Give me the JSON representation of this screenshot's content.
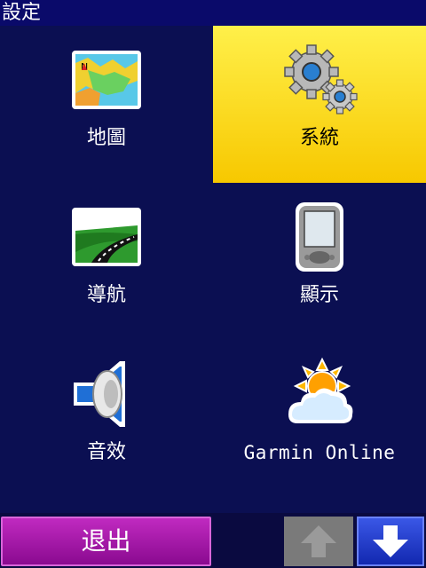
{
  "title": "設定",
  "colors": {
    "background": "#0b0f52",
    "selected": "#f7c800",
    "exit_button": "#a31aa8",
    "down_button": "#1f3ad0",
    "up_button_disabled": "#7a7a7a"
  },
  "tiles": [
    {
      "label": "地圖",
      "icon": "map-icon",
      "selected": false
    },
    {
      "label": "系統",
      "icon": "gears-icon",
      "selected": true
    },
    {
      "label": "導航",
      "icon": "road-icon",
      "selected": false
    },
    {
      "label": "顯示",
      "icon": "pda-display-icon",
      "selected": false
    },
    {
      "label": "音效",
      "icon": "speaker-icon",
      "selected": false
    },
    {
      "label": "Garmin Online",
      "icon": "weather-icon",
      "selected": false
    }
  ],
  "bottom": {
    "exit_label": "退出",
    "up_icon": "arrow-up-icon",
    "down_icon": "arrow-down-icon"
  }
}
